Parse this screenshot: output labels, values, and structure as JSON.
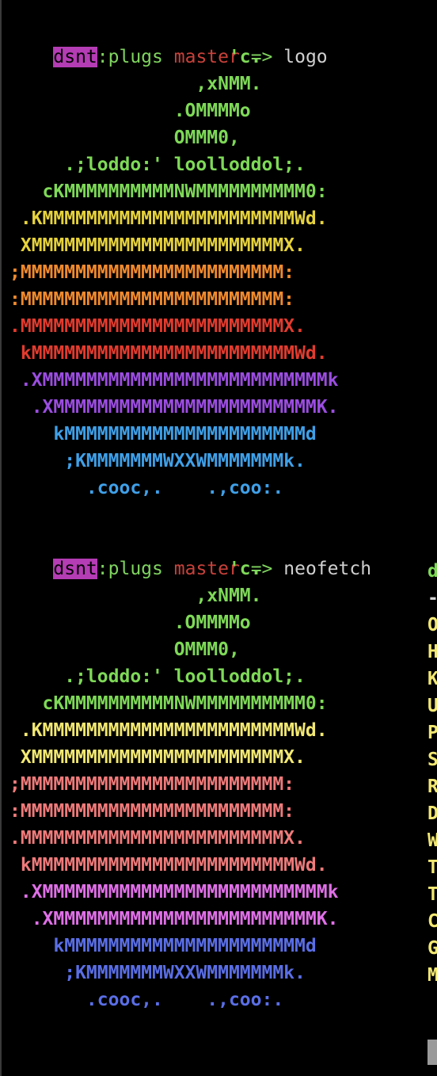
{
  "prompt": {
    "user": "dsnt",
    "sep": ":",
    "dir": "plugs",
    "branch": "master",
    "arrow": "=>"
  },
  "commands": [
    "logo",
    "neofetch"
  ],
  "logo_lines": [
    "                    'c.",
    "                 ,xNMM.",
    "               .OMMMMo",
    "               OMMM0,",
    "     .;loddo:' loolloddol;.",
    "   cKMMMMMMMMMMNWMMMMMMMMMM0:",
    " .KMMMMMMMMMMMMMMMMMMMMMMMWd.",
    " XMMMMMMMMMMMMMMMMMMMMMMMX.",
    ";MMMMMMMMMMMMMMMMMMMMMMMM:",
    ":MMMMMMMMMMMMMMMMMMMMMMMM:",
    ".MMMMMMMMMMMMMMMMMMMMMMMMX.",
    " kMMMMMMMMMMMMMMMMMMMMMMMMWd.",
    " .XMMMMMMMMMMMMMMMMMMMMMMMMMMk",
    "  .XMMMMMMMMMMMMMMMMMMMMMMMMK.",
    "    kMMMMMMMMMMMMMMMMMMMMMMd",
    "     ;KMMMMMMMWXXWMMMMMMMk.",
    "       .cooc,.    .,coo:."
  ],
  "logo_colors_first": [
    "#7ed957",
    "#7ed957",
    "#7ed957",
    "#7ed957",
    "#7ed957",
    "#7ed957",
    "#e6d23c",
    "#e6d23c",
    "#f08a2e",
    "#f08a2e",
    "#e23b2e",
    "#e23b2e",
    "#9b4de0",
    "#9b4de0",
    "#3fa0e8",
    "#3fa0e8",
    "#3fa0e8"
  ],
  "logo_colors_second": [
    "#7ed957",
    "#7ed957",
    "#7ed957",
    "#7ed957",
    "#7ed957",
    "#7ed957",
    "#f2e872",
    "#f2e872",
    "#f07a7a",
    "#f07a7a",
    "#f07a7a",
    "#f07a7a",
    "#e070e8",
    "#e070e8",
    "#5a6ee6",
    "#5a6ee6",
    "#5a6ee6"
  ],
  "neofetch_info": {
    "title_initial": "d",
    "separator_initial": "-",
    "keys": [
      "O",
      "H",
      "K",
      "U",
      "P",
      "S",
      "R",
      "D",
      "W",
      "T",
      "T",
      "C",
      "G",
      "M"
    ],
    "title_color": "#7ed957",
    "separator_color": "#d0d0d0",
    "key_color": "#f2e872"
  }
}
